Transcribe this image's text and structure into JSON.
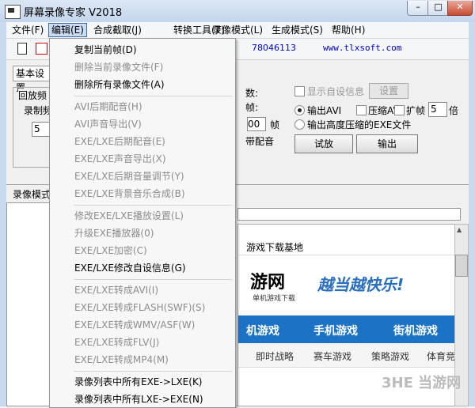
{
  "window": {
    "title": "屏幕录像专家 V2018",
    "minimize": "–",
    "maximize": "□",
    "close": "✕"
  },
  "menubar": [
    "文件(F)",
    "编辑(E)",
    "合成截取(J)",
    "转换工具(T)",
    "录像模式(L)",
    "生成模式(S)",
    "帮助(H)"
  ],
  "toolbar": {
    "phone": "78046113",
    "website": "www.tlxsoft.com"
  },
  "main": {
    "tab_basic": "基本设置",
    "group_label": "回放频",
    "record_label": "录制频",
    "value_5": "5",
    "frag_a": "数:",
    "frag_b": "帧:",
    "frag_00": "00",
    "frag_frame": "帧",
    "frag_dub": "带配音",
    "show_info": "显示自设信息",
    "settings": "设置",
    "output_avi": "输出AVI",
    "compress_avi": "压缩AVI",
    "expand_frames": "扩帧",
    "expand_value": "5",
    "times": "倍",
    "output_exe": "输出高度压缩的EXE文件",
    "preview": "试放",
    "output": "输出",
    "mode_label": "录像模式"
  },
  "web_preview": {
    "title": "游戏下载基地",
    "logo": "游网",
    "sub": "单机游戏下载",
    "slogan": "越当越快乐!",
    "nav": [
      "机游戏",
      "手机游戏",
      "街机游戏"
    ],
    "sub_nav": [
      "即时战略",
      "赛车游戏",
      "策略游戏",
      "体育竞"
    ]
  },
  "dropdown": {
    "items": [
      {
        "label": "复制当前帧(D)",
        "enabled": true
      },
      {
        "label": "删除当前录像文件(F)",
        "enabled": false
      },
      {
        "label": "删除所有录像文件(A)",
        "enabled": true
      },
      {
        "label": "AVI后期配音(H)",
        "enabled": false
      },
      {
        "label": "AVI声音导出(V)",
        "enabled": false
      },
      {
        "label": "EXE/LXE后期配音(E)",
        "enabled": false
      },
      {
        "label": "EXE/LXE声音导出(X)",
        "enabled": false
      },
      {
        "label": "EXE/LXE后期音量调节(Y)",
        "enabled": false
      },
      {
        "label": "EXE/LXE背景音乐合成(B)",
        "enabled": false
      },
      {
        "label": "修改EXE/LXE播放设置(L)",
        "enabled": false
      },
      {
        "label": "升级EXE播放器(0)",
        "enabled": false
      },
      {
        "label": "EXE/LXE加密(C)",
        "enabled": false
      },
      {
        "label": "EXE/LXE修改自设信息(G)",
        "enabled": true
      },
      {
        "label": "EXE/LXE转成AVI(I)",
        "enabled": false
      },
      {
        "label": "EXE/LXE转成FLASH(SWF)(S)",
        "enabled": false
      },
      {
        "label": "EXE/LXE转成WMV/ASF(W)",
        "enabled": false
      },
      {
        "label": "EXE/LXE转成FLV(J)",
        "enabled": false
      },
      {
        "label": "EXE/LXE转成MP4(M)",
        "enabled": false
      },
      {
        "label": "录像列表中所有EXE->LXE(K)",
        "enabled": true
      },
      {
        "label": "录像列表中所有LXE->EXE(N)",
        "enabled": true
      }
    ]
  },
  "watermark": "3HE 当游网"
}
